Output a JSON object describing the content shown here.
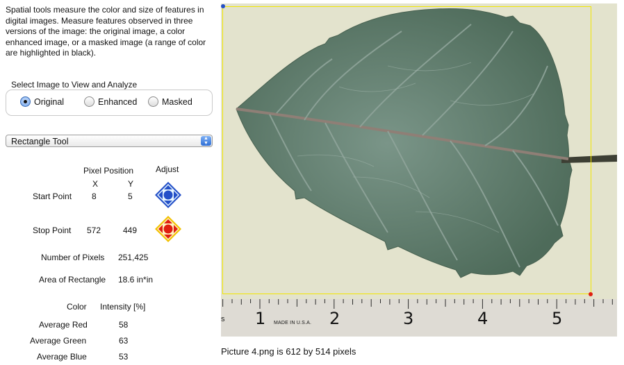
{
  "description": "Spatial tools measure the color and size of features in digital images.  Measure features observed in three versions of the image: the original image, a color enhanced image, or a masked image (a range of color are highlighted in black).",
  "image_select": {
    "title": "Select Image to View and Analyze",
    "options": [
      "Original",
      "Enhanced",
      "Masked"
    ],
    "selected": "Original"
  },
  "tool_select": {
    "value": "Rectangle Tool"
  },
  "position": {
    "header": "Pixel Position",
    "adjust_header": "Adjust",
    "x_header": "X",
    "y_header": "Y",
    "start": {
      "label": "Start Point",
      "x": "8",
      "y": "5"
    },
    "stop": {
      "label": "Stop Point",
      "x": "572",
      "y": "449"
    }
  },
  "measurements": {
    "pixels_label": "Number of Pixels",
    "pixels_value": "251,425",
    "area_label": "Area of Rectangle",
    "area_value": "18.6 in*in"
  },
  "color": {
    "color_header": "Color",
    "intensity_header": "Intensity [%]",
    "red_label": "Average Red",
    "red_value": "58",
    "green_label": "Average Green",
    "green_value": "63",
    "blue_label": "Average Blue",
    "blue_value": "53"
  },
  "ruler": {
    "numbers": [
      "1",
      "2",
      "3",
      "4",
      "5"
    ],
    "made_in": "MADE IN U.S.A."
  },
  "caption": "Picture 4.png is 612 by 514 pixels",
  "colors": {
    "selection": "#f2e600",
    "start_marker": "#2450c8",
    "stop_marker": "#e02010",
    "leaf": "#5c7a6a",
    "background": "#e3e3cd"
  },
  "icons": {
    "start_adjust": "blue-diamond-arrows-icon",
    "stop_adjust": "red-diamond-arrows-icon"
  }
}
